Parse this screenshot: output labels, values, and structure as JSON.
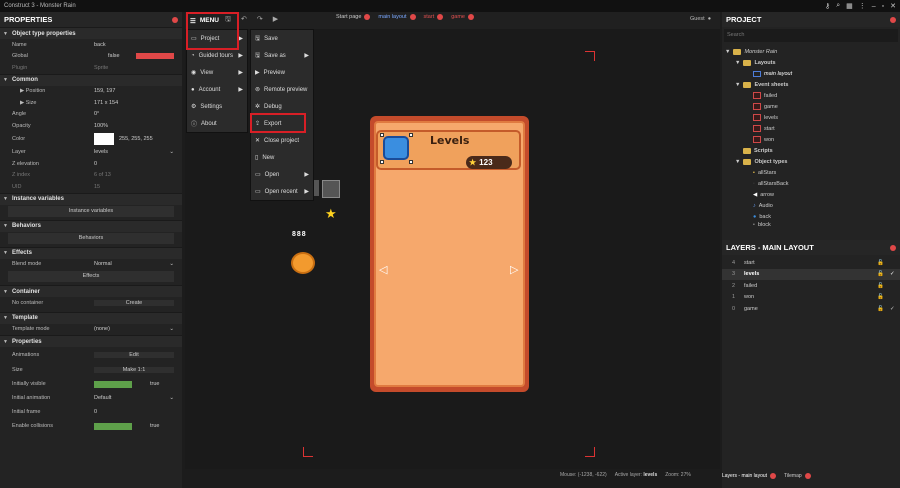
{
  "window": {
    "title": "Construct 3 - Monster Rain"
  },
  "toolbar": {
    "menu_label": "MENU",
    "guest_label": "Guest",
    "tabs": [
      {
        "label": "Start page"
      },
      {
        "label": "main layout"
      },
      {
        "label": "start"
      },
      {
        "label": "game"
      }
    ]
  },
  "menu": {
    "col1": [
      {
        "label": "Project"
      },
      {
        "label": "Guided tours"
      },
      {
        "label": "View"
      },
      {
        "label": "Account"
      },
      {
        "label": "Settings"
      },
      {
        "label": "About"
      }
    ],
    "col2": [
      {
        "label": "Save"
      },
      {
        "label": "Save as"
      },
      {
        "label": "Preview"
      },
      {
        "label": "Remote preview"
      },
      {
        "label": "Debug"
      },
      {
        "label": "Export"
      },
      {
        "label": "Close project"
      },
      {
        "label": "New"
      },
      {
        "label": "Open"
      },
      {
        "label": "Open recent"
      }
    ]
  },
  "properties": {
    "title": "PROPERTIES",
    "sec_obj": "Object type properties",
    "name_label": "Name",
    "name_value": "back",
    "global_label": "Global",
    "global_value": "false",
    "plugin_label": "Plugin",
    "plugin_value": "Sprite",
    "sec_common": "Common",
    "position_label": "Position",
    "position_value": "159, 197",
    "size_label": "Size",
    "size_value": "171 x 154",
    "angle_label": "Angle",
    "angle_value": "0°",
    "opacity_label": "Opacity",
    "opacity_value": "100%",
    "color_label": "Color",
    "color_value": "255, 255, 255",
    "layer_label": "Layer",
    "layer_value": "levels",
    "zelev_label": "Z elevation",
    "zelev_value": "0",
    "zindex_label": "Z index",
    "zindex_value": "6 of 13",
    "uid_label": "UID",
    "uid_value": "15",
    "sec_instvars": "Instance variables",
    "instvars_btn": "Instance variables",
    "sec_behaviors": "Behaviors",
    "behaviors_btn": "Behaviors",
    "sec_effects": "Effects",
    "blend_label": "Blend mode",
    "blend_value": "Normal",
    "effects_btn": "Effects",
    "sec_container": "Container",
    "nocontainer_label": "No container",
    "create_btn": "Create",
    "sec_template": "Template",
    "tmode_label": "Template mode",
    "tmode_value": "(none)",
    "sec_props": "Properties",
    "anim_label": "Animations",
    "anim_btn": "Edit",
    "psize_label": "Size",
    "psize_btn": "Make 1:1",
    "vis_label": "Initially visible",
    "vis_value": "true",
    "ianim_label": "Initial animation",
    "ianim_value": "Default",
    "iframe_label": "Initial frame",
    "iframe_value": "0",
    "coll_label": "Enable collisions",
    "coll_value": "true"
  },
  "canvas": {
    "levels_title": "Levels",
    "coins": "123",
    "status_mouse": "Mouse: (-1238, -622)",
    "status_layer_label": "Active layer:",
    "status_layer": "levels",
    "status_zoom": "Zoom: 27%"
  },
  "project": {
    "title": "PROJECT",
    "search_placeholder": "Search",
    "tree": [
      {
        "label": "Monster Rain"
      },
      {
        "label": "Layouts"
      },
      {
        "label": "main layout"
      },
      {
        "label": "Event sheets"
      },
      {
        "label": "failed"
      },
      {
        "label": "game"
      },
      {
        "label": "levels"
      },
      {
        "label": "start"
      },
      {
        "label": "won"
      },
      {
        "label": "Scripts"
      },
      {
        "label": "Object types"
      },
      {
        "label": "allStars"
      },
      {
        "label": "allStarsBack"
      },
      {
        "label": "arrow"
      },
      {
        "label": "Audio"
      },
      {
        "label": "back"
      },
      {
        "label": "block"
      }
    ]
  },
  "layers": {
    "title": "LAYERS - MAIN LAYOUT",
    "rows": [
      {
        "num": "4",
        "name": "start"
      },
      {
        "num": "3",
        "name": "levels"
      },
      {
        "num": "2",
        "name": "failed"
      },
      {
        "num": "1",
        "name": "won"
      },
      {
        "num": "0",
        "name": "game"
      }
    ]
  },
  "bottom": {
    "tab1": "Layers - main layout",
    "tab2": "Tilemap"
  }
}
